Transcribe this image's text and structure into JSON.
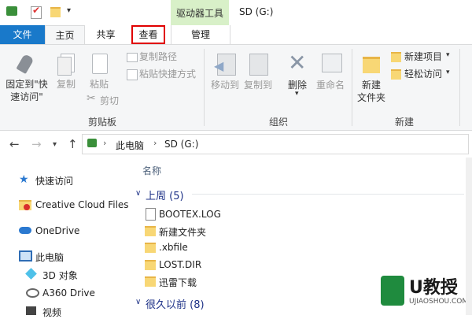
{
  "titlebar": {
    "context_tab_group": "驱动器工具",
    "window_title": "SD (G:)"
  },
  "tabs": [
    {
      "label": "文件"
    },
    {
      "label": "主页"
    },
    {
      "label": "共享"
    },
    {
      "label": "查看"
    },
    {
      "label": "管理"
    }
  ],
  "ribbon": {
    "clipboard": {
      "pin_label_1": "固定到\"快",
      "pin_label_2": "速访问\"",
      "copy": "复制",
      "paste": "粘贴",
      "copy_path": "复制路径",
      "paste_shortcut": "粘贴快捷方式",
      "cut": "剪切",
      "group_label": "剪贴板"
    },
    "organize": {
      "move_to": "移动到",
      "copy_to": "复制到",
      "delete": "删除",
      "rename": "重命名",
      "group_label": "组织"
    },
    "new": {
      "new_folder_1": "新建",
      "new_folder_2": "文件夹",
      "new_item": "新建项目",
      "easy_access": "轻松访问",
      "group_label": "新建"
    }
  },
  "address": {
    "crumbs": [
      "此电脑",
      "SD (G:)"
    ]
  },
  "nav_pane": {
    "items": [
      {
        "label": "快速访问",
        "icon": "star-icon"
      },
      {
        "label": "Creative Cloud Files",
        "icon": "creative-cloud-icon"
      },
      {
        "label": "OneDrive",
        "icon": "cloud-icon"
      },
      {
        "label": "此电脑",
        "icon": "computer-icon"
      },
      {
        "label": "3D 对象",
        "icon": "3d-objects-icon"
      },
      {
        "label": "A360 Drive",
        "icon": "a360-icon"
      },
      {
        "label": "视频",
        "icon": "video-icon"
      }
    ]
  },
  "content": {
    "column_name": "名称",
    "groups": [
      {
        "label": "上周 (5)"
      },
      {
        "label": "很久以前 (8)"
      }
    ],
    "files": [
      {
        "name": "BOOTEX.LOG",
        "type": "document"
      },
      {
        "name": "新建文件夹",
        "type": "folder"
      },
      {
        "name": ".xbfile",
        "type": "folder"
      },
      {
        "name": "LOST.DIR",
        "type": "folder"
      },
      {
        "name": "迅雷下载",
        "type": "folder"
      }
    ]
  },
  "watermark": {
    "brand": "U教授",
    "url": "UJIAOSHOU.COM"
  },
  "colors": {
    "file_tab": "#1979ca",
    "context_group": "#d8f0c8",
    "highlight_box": "#e00000",
    "group_header": "#1e3287",
    "folder": "#f8d775"
  }
}
